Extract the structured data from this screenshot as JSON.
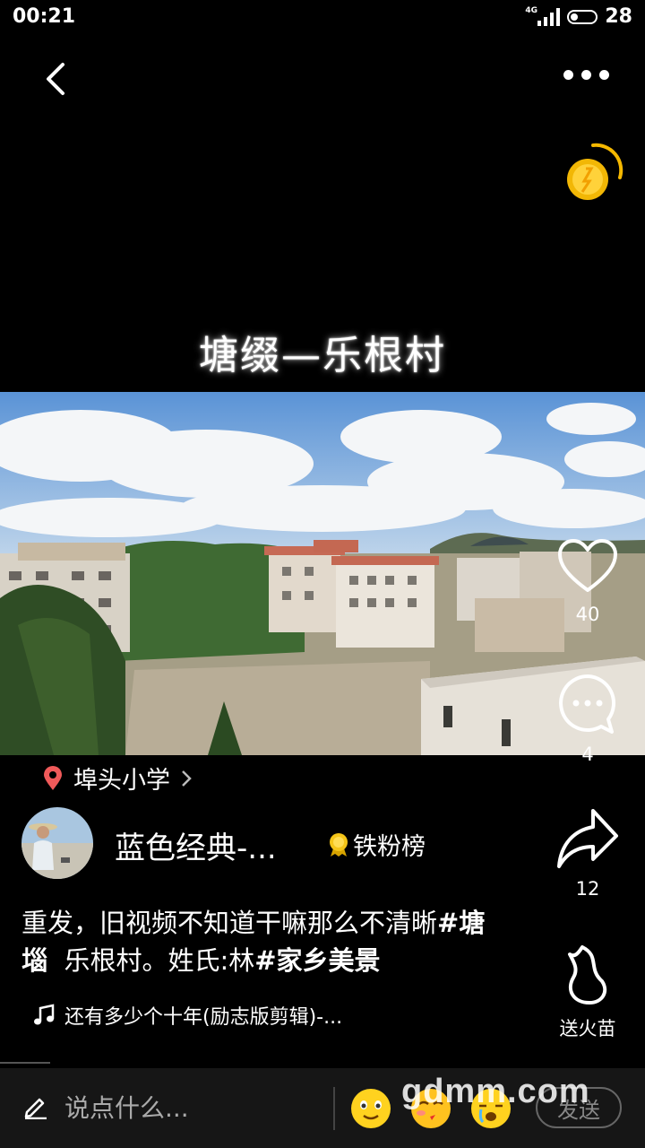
{
  "status_bar": {
    "time": "00:21",
    "network": "4G",
    "battery": "28"
  },
  "video": {
    "title": "塘缀—乐根村"
  },
  "actions": {
    "like_count": "40",
    "comment_count": "4",
    "share_count": "12",
    "gift_label": "送火苗"
  },
  "location": {
    "name": "埠头小学"
  },
  "author": {
    "name": "蓝色经典-...",
    "badge_label": "铁粉榜"
  },
  "caption": {
    "part1": "重发，旧视频不知道干嘛那么不清晰",
    "hashtag1": "#塘堖",
    "part2": "乐根村。姓氏:林",
    "hashtag2": "#家乡美景"
  },
  "music": {
    "title": "还有多少个十年(励志版剪辑)-..."
  },
  "comment_bar": {
    "placeholder": "说点什么...",
    "send_label": "发送"
  },
  "watermark": "gdmm.com",
  "icons": [
    "back-arrow-icon",
    "more-icon",
    "coin-icon",
    "heart-icon",
    "comment-icon",
    "share-icon",
    "flame-icon",
    "location-pin-icon",
    "chevron-right-icon",
    "medal-icon",
    "music-note-icon",
    "pencil-icon",
    "emoji-smile-icon",
    "emoji-kiss-icon",
    "emoji-cry-icon"
  ]
}
